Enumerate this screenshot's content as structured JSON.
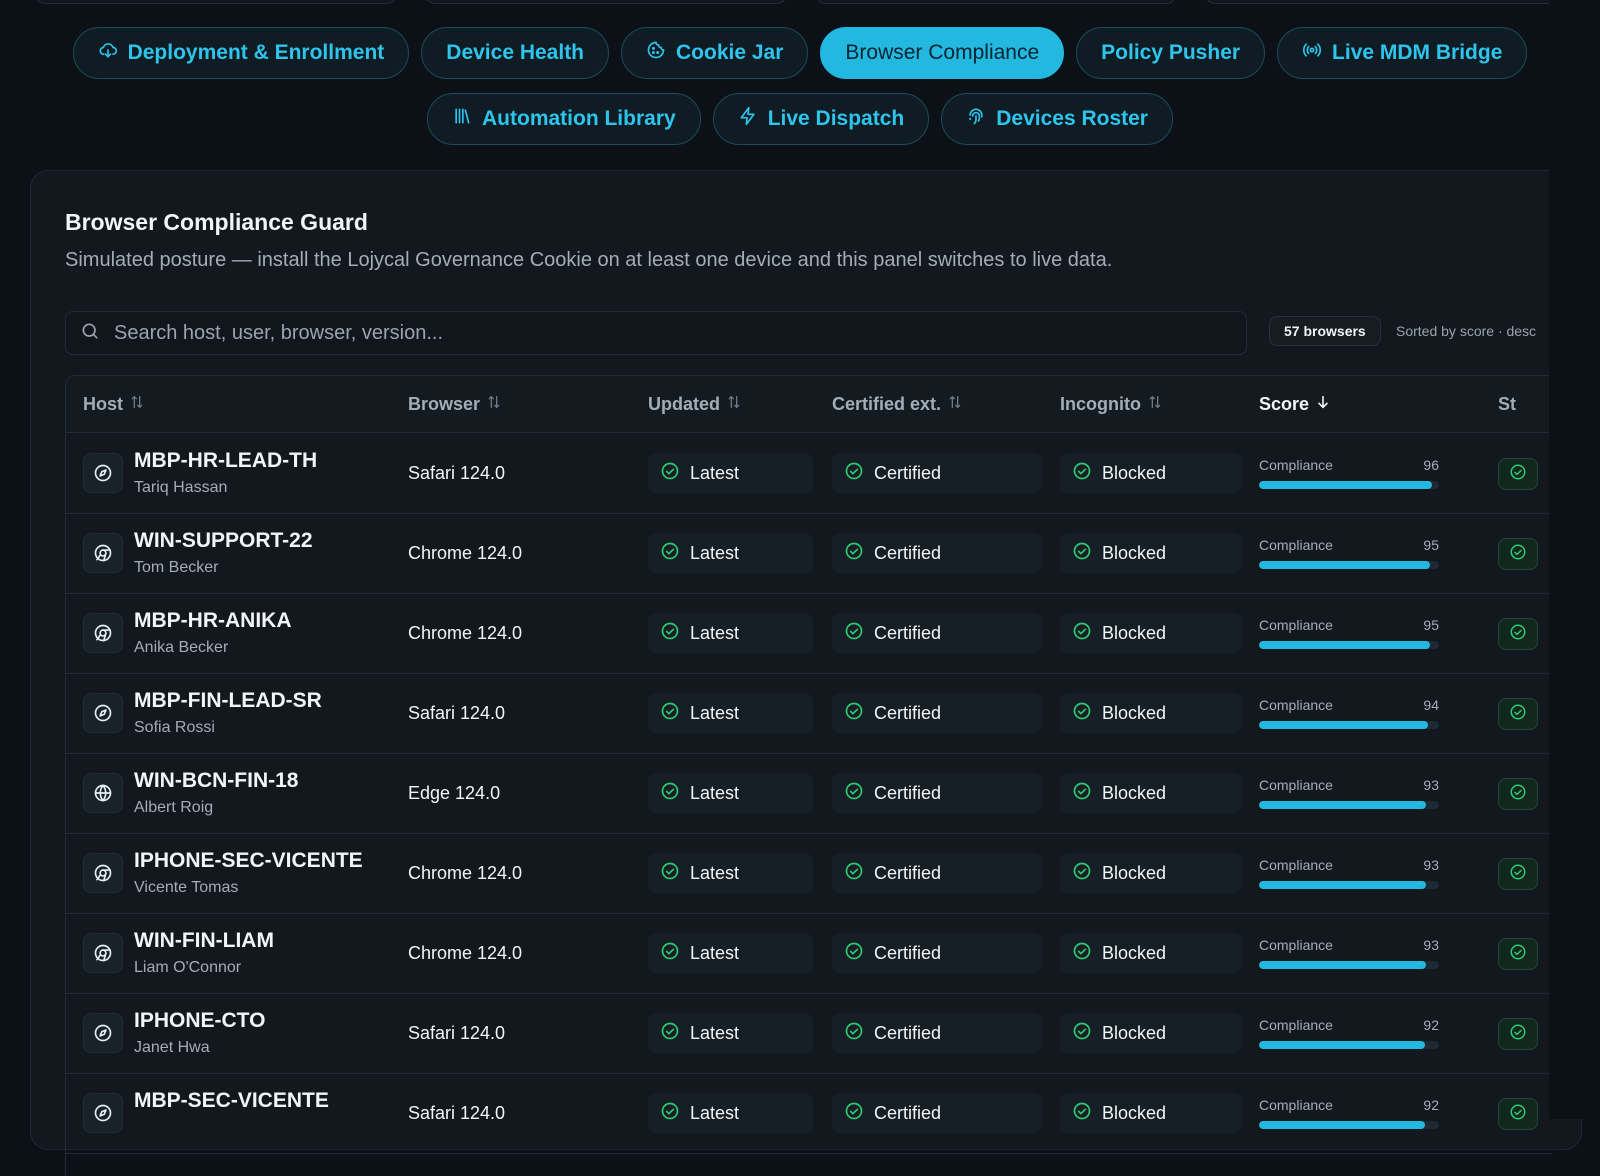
{
  "nav": {
    "tabs": [
      {
        "label": "Deployment & Enrollment",
        "icon": "cloud-download-icon",
        "active": false
      },
      {
        "label": "Device Health",
        "icon": "",
        "active": false
      },
      {
        "label": "Cookie Jar",
        "icon": "cookie-icon",
        "active": false
      },
      {
        "label": "Browser Compliance",
        "icon": "",
        "active": true
      },
      {
        "label": "Policy Pusher",
        "icon": "",
        "active": false
      },
      {
        "label": "Live MDM Bridge",
        "icon": "broadcast-icon",
        "active": false
      },
      {
        "label": "Automation Library",
        "icon": "library-icon",
        "active": false
      },
      {
        "label": "Live Dispatch",
        "icon": "lightning-icon",
        "active": false
      },
      {
        "label": "Devices Roster",
        "icon": "fingerprint-icon",
        "active": false
      }
    ]
  },
  "panel": {
    "title": "Browser Compliance Guard",
    "subtitle": "Simulated posture — install the Lojycal Governance Cookie on at least one device and this panel switches to live data.",
    "search_placeholder": "Search host, user, browser, version...",
    "count_badge": "57 browsers",
    "sort_note": "Sorted by score · desc"
  },
  "table": {
    "columns": {
      "host": "Host",
      "browser": "Browser",
      "updated": "Updated",
      "certified": "Certified ext.",
      "incognito": "Incognito",
      "score": "Score",
      "status": "St"
    },
    "score_label": "Compliance",
    "rows": [
      {
        "host": "MBP-HR-LEAD-TH",
        "user": "Tariq Hassan",
        "browser": "Safari 124.0",
        "browser_icon": "compass-icon",
        "updated": "Latest",
        "certified": "Certified",
        "incognito": "Blocked",
        "score": "96"
      },
      {
        "host": "WIN-SUPPORT-22",
        "user": "Tom Becker",
        "browser": "Chrome 124.0",
        "browser_icon": "chrome-icon",
        "updated": "Latest",
        "certified": "Certified",
        "incognito": "Blocked",
        "score": "95"
      },
      {
        "host": "MBP-HR-ANIKA",
        "user": "Anika Becker",
        "browser": "Chrome 124.0",
        "browser_icon": "chrome-icon",
        "updated": "Latest",
        "certified": "Certified",
        "incognito": "Blocked",
        "score": "95"
      },
      {
        "host": "MBP-FIN-LEAD-SR",
        "user": "Sofia Rossi",
        "browser": "Safari 124.0",
        "browser_icon": "compass-icon",
        "updated": "Latest",
        "certified": "Certified",
        "incognito": "Blocked",
        "score": "94"
      },
      {
        "host": "WIN-BCN-FIN-18",
        "user": "Albert Roig",
        "browser": "Edge 124.0",
        "browser_icon": "globe-icon",
        "updated": "Latest",
        "certified": "Certified",
        "incognito": "Blocked",
        "score": "93"
      },
      {
        "host": "IPHONE-SEC-VICENTE",
        "user": "Vicente Tomas",
        "browser": "Chrome 124.0",
        "browser_icon": "chrome-icon",
        "updated": "Latest",
        "certified": "Certified",
        "incognito": "Blocked",
        "score": "93"
      },
      {
        "host": "WIN-FIN-LIAM",
        "user": "Liam O'Connor",
        "browser": "Chrome 124.0",
        "browser_icon": "chrome-icon",
        "updated": "Latest",
        "certified": "Certified",
        "incognito": "Blocked",
        "score": "93"
      },
      {
        "host": "IPHONE-CTO",
        "user": "Janet Hwa",
        "browser": "Safari 124.0",
        "browser_icon": "compass-icon",
        "updated": "Latest",
        "certified": "Certified",
        "incognito": "Blocked",
        "score": "92"
      },
      {
        "host": "MBP-SEC-VICENTE",
        "user": "",
        "browser": "Safari 124.0",
        "browser_icon": "compass-icon",
        "updated": "Latest",
        "certified": "Certified",
        "incognito": "Blocked",
        "score": "92"
      }
    ]
  },
  "colors": {
    "accent": "#22b8e0",
    "ok_green": "#2ecc71",
    "background": "#0b1117"
  }
}
